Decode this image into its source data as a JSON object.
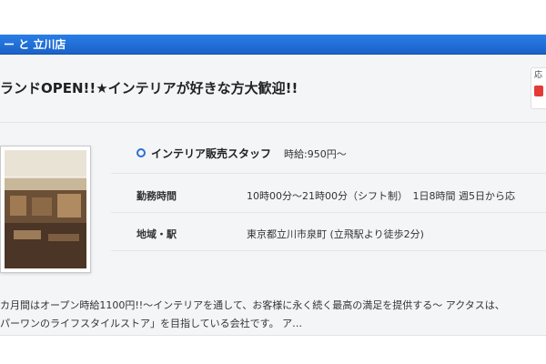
{
  "header": {
    "store_name": "ー と 立川店"
  },
  "listing": {
    "headline": "ランドOPEN!!★インテリアが好きな方大歓迎!!",
    "badge_text": "応",
    "position": {
      "title": "インテリア販売スタッフ",
      "wage": "時給:950円〜"
    },
    "details": [
      {
        "label": "勤務時間",
        "value": "10時00分〜21時00分（シフト制）　1日8時間 週5日から応"
      },
      {
        "label": "地域・駅",
        "value": "東京都立川市泉町 (立飛駅より徒歩2分)"
      }
    ],
    "description_lines": [
      "カ月間はオープン時給1100円!!〜インテリアを通して、お客様に永く続く最高の満足を提供する〜 アクタスは、",
      "パーワンのライフスタイルストア」を目指している会社です。 ア…"
    ]
  },
  "colors": {
    "header_blue": "#1a62c8",
    "accent_blue": "#2c6fd1",
    "badge_red": "#e53935"
  },
  "icons": {
    "position_marker": "circle-bullet-icon"
  }
}
